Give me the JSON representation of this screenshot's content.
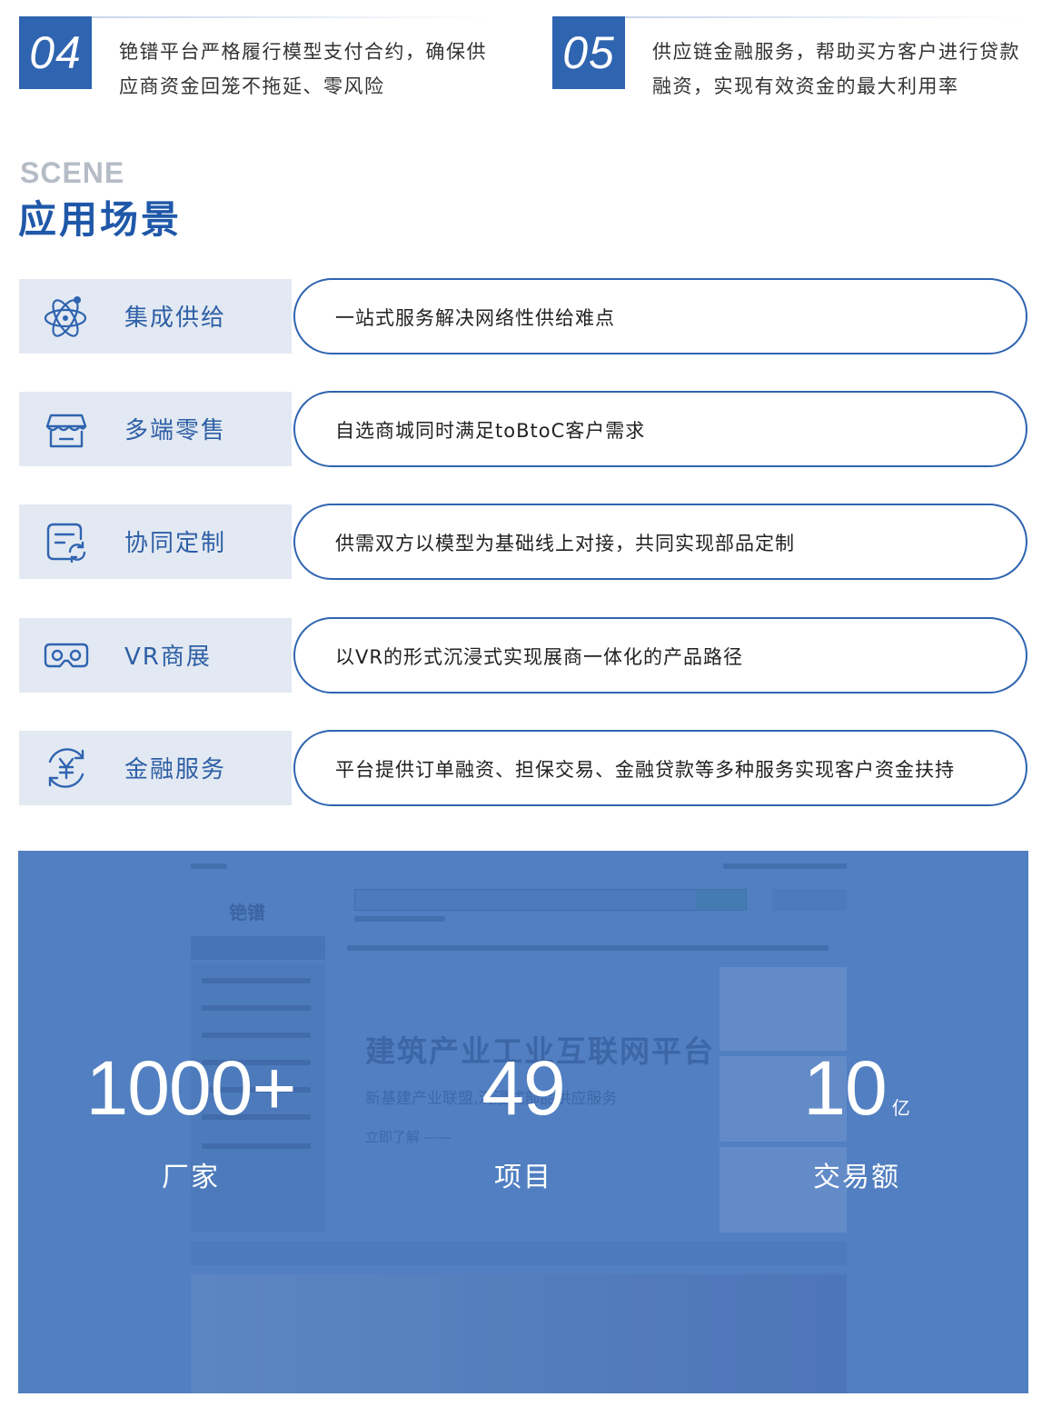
{
  "features": [
    {
      "num": "04",
      "text": "铯镨平台严格履行模型支付合约，确保供应商资金回笼不拖延、零风险"
    },
    {
      "num": "05",
      "text": "供应链金融服务，帮助买方客户进行贷款融资，实现有效资金的最大利用率"
    }
  ],
  "section": {
    "en": "SCENE",
    "cn": "应用场景"
  },
  "scenes": [
    {
      "icon": "atom-icon",
      "title": "集成供给",
      "desc": "一站式服务解决网络性供给难点"
    },
    {
      "icon": "store-icon",
      "title": "多端零售",
      "desc": "自选商城同时满足toBtoC客户需求"
    },
    {
      "icon": "sync-doc-icon",
      "title": "协同定制",
      "desc": "供需双方以模型为基础线上对接，共同实现部品定制"
    },
    {
      "icon": "vr-goggles-icon",
      "title": "VR商展",
      "desc": "以VR的形式沉浸式实现展商一体化的产品路径"
    },
    {
      "icon": "yen-cycle-icon",
      "title": "金融服务",
      "desc": "平台提供订单融资、担保交易、金融贷款等多种服务实现客户资金扶持"
    }
  ],
  "banner": {
    "bg_logo": "铯镨",
    "bg_title": "建筑产业工业互联网平台",
    "bg_subtitle": "新基建产业联盟,沉浸式部品供应服务",
    "bg_link": "立即了解 ——",
    "stats": [
      {
        "value": "1000+",
        "unit": "",
        "label": "厂家"
      },
      {
        "value": "49",
        "unit": "",
        "label": "项目"
      },
      {
        "value": "10",
        "unit": "亿",
        "label": "交易额"
      }
    ]
  },
  "colors": {
    "accent": "#2f64b0",
    "heading": "#1f58a8",
    "tag_bg": "#e3e9f2",
    "banner_bg": "#5b86c4"
  }
}
